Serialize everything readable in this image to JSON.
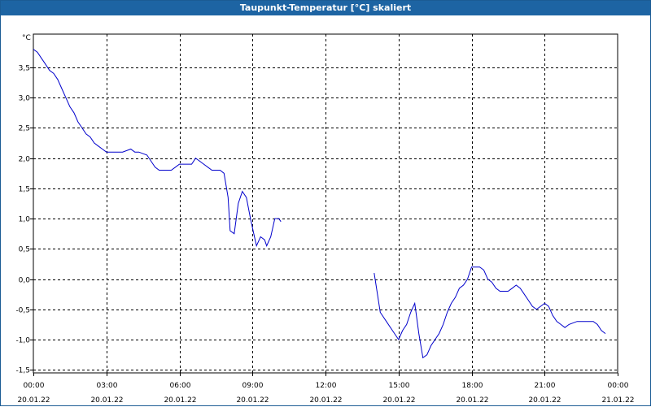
{
  "window": {
    "title": "Taupunkt-Temperatur [°C] skaliert"
  },
  "chart_data": {
    "type": "line",
    "title": "Taupunkt-Temperatur [°C] skaliert",
    "ylabel": "°C",
    "xlabel": "",
    "grid": true,
    "line_color": "#0000cc",
    "ylim": [
      -1.55,
      4.05
    ],
    "xlim": [
      "00:00",
      "24:00"
    ],
    "y_ticks": [
      "3,5",
      "3,0",
      "2,5",
      "2,0",
      "1,5",
      "1,0",
      "0,5",
      "0,0",
      "-0,5",
      "-1,0",
      "-1,5"
    ],
    "y_tick_values": [
      3.5,
      3.0,
      2.5,
      2.0,
      1.5,
      1.0,
      0.5,
      0.0,
      -0.5,
      -1.0,
      -1.5
    ],
    "x_ticks": [
      {
        "time": "00:00",
        "date": "20.01.22"
      },
      {
        "time": "03:00",
        "date": "20.01.22"
      },
      {
        "time": "06:00",
        "date": "20.01.22"
      },
      {
        "time": "09:00",
        "date": "20.01.22"
      },
      {
        "time": "12:00",
        "date": "20.01.22"
      },
      {
        "time": "15:00",
        "date": "20.01.22"
      },
      {
        "time": "18:00",
        "date": "20.01.22"
      },
      {
        "time": "21:00",
        "date": "20.01.22"
      },
      {
        "time": "00:00",
        "date": "21.01.22"
      }
    ],
    "x_tick_hours": [
      0,
      3,
      6,
      9,
      12,
      15,
      18,
      21,
      24
    ],
    "series": [
      {
        "name": "",
        "segments": [
          [
            [
              "00:00",
              3.8
            ],
            [
              "00:10",
              3.75
            ],
            [
              "00:20",
              3.65
            ],
            [
              "00:30",
              3.55
            ],
            [
              "00:40",
              3.45
            ],
            [
              "00:50",
              3.4
            ],
            [
              "01:00",
              3.3
            ],
            [
              "01:10",
              3.15
            ],
            [
              "01:20",
              3.0
            ],
            [
              "01:30",
              2.85
            ],
            [
              "01:40",
              2.75
            ],
            [
              "01:50",
              2.6
            ],
            [
              "02:00",
              2.5
            ],
            [
              "02:10",
              2.4
            ],
            [
              "02:20",
              2.35
            ],
            [
              "02:30",
              2.25
            ],
            [
              "02:40",
              2.2
            ],
            [
              "02:50",
              2.15
            ],
            [
              "03:00",
              2.1
            ],
            [
              "03:20",
              2.1
            ],
            [
              "03:40",
              2.1
            ],
            [
              "04:00",
              2.15
            ],
            [
              "04:10",
              2.1
            ],
            [
              "04:20",
              2.1
            ],
            [
              "04:40",
              2.05
            ],
            [
              "04:50",
              1.95
            ],
            [
              "05:00",
              1.85
            ],
            [
              "05:10",
              1.8
            ],
            [
              "05:20",
              1.8
            ],
            [
              "05:40",
              1.8
            ],
            [
              "05:50",
              1.85
            ],
            [
              "06:00",
              1.9
            ],
            [
              "06:20",
              1.9
            ],
            [
              "06:30",
              1.9
            ],
            [
              "06:40",
              2.0
            ],
            [
              "06:50",
              1.95
            ],
            [
              "07:00",
              1.9
            ],
            [
              "07:10",
              1.85
            ],
            [
              "07:20",
              1.8
            ],
            [
              "07:30",
              1.8
            ],
            [
              "07:40",
              1.8
            ],
            [
              "07:50",
              1.75
            ],
            [
              "08:00",
              1.35
            ],
            [
              "08:05",
              0.8
            ],
            [
              "08:15",
              0.75
            ],
            [
              "08:25",
              1.25
            ],
            [
              "08:35",
              1.45
            ],
            [
              "08:45",
              1.35
            ],
            [
              "08:55",
              1.0
            ],
            [
              "09:05",
              0.7
            ],
            [
              "09:10",
              0.55
            ],
            [
              "09:20",
              0.7
            ],
            [
              "09:30",
              0.65
            ],
            [
              "09:35",
              0.55
            ],
            [
              "09:45",
              0.7
            ],
            [
              "09:55",
              1.0
            ],
            [
              "10:05",
              1.0
            ],
            [
              "10:10",
              0.95
            ]
          ],
          [
            [
              "14:00",
              0.1
            ],
            [
              "14:15",
              -0.55
            ],
            [
              "14:30",
              -0.7
            ],
            [
              "14:45",
              -0.85
            ],
            [
              "15:00",
              -1.0
            ],
            [
              "15:10",
              -0.85
            ],
            [
              "15:20",
              -0.75
            ],
            [
              "15:30",
              -0.55
            ],
            [
              "15:40",
              -0.4
            ],
            [
              "15:50",
              -0.9
            ],
            [
              "16:00",
              -1.3
            ],
            [
              "16:10",
              -1.25
            ],
            [
              "16:20",
              -1.1
            ],
            [
              "16:30",
              -1.0
            ],
            [
              "16:40",
              -0.9
            ],
            [
              "16:50",
              -0.75
            ],
            [
              "17:00",
              -0.55
            ],
            [
              "17:10",
              -0.4
            ],
            [
              "17:20",
              -0.3
            ],
            [
              "17:30",
              -0.15
            ],
            [
              "17:40",
              -0.1
            ],
            [
              "17:50",
              0.0
            ],
            [
              "18:00",
              0.2
            ],
            [
              "18:10",
              0.2
            ],
            [
              "18:20",
              0.2
            ],
            [
              "18:30",
              0.15
            ],
            [
              "18:40",
              0.0
            ],
            [
              "18:50",
              -0.05
            ],
            [
              "19:00",
              -0.15
            ],
            [
              "19:10",
              -0.2
            ],
            [
              "19:20",
              -0.2
            ],
            [
              "19:30",
              -0.2
            ],
            [
              "19:40",
              -0.15
            ],
            [
              "19:50",
              -0.1
            ],
            [
              "20:00",
              -0.15
            ],
            [
              "20:10",
              -0.25
            ],
            [
              "20:20",
              -0.35
            ],
            [
              "20:30",
              -0.45
            ],
            [
              "20:40",
              -0.5
            ],
            [
              "20:50",
              -0.45
            ],
            [
              "21:00",
              -0.4
            ],
            [
              "21:10",
              -0.45
            ],
            [
              "21:20",
              -0.6
            ],
            [
              "21:30",
              -0.7
            ],
            [
              "21:40",
              -0.75
            ],
            [
              "21:50",
              -0.8
            ],
            [
              "22:00",
              -0.75
            ],
            [
              "22:20",
              -0.7
            ],
            [
              "22:40",
              -0.7
            ],
            [
              "23:00",
              -0.7
            ],
            [
              "23:10",
              -0.75
            ],
            [
              "23:20",
              -0.85
            ],
            [
              "23:30",
              -0.9
            ]
          ]
        ]
      }
    ]
  }
}
